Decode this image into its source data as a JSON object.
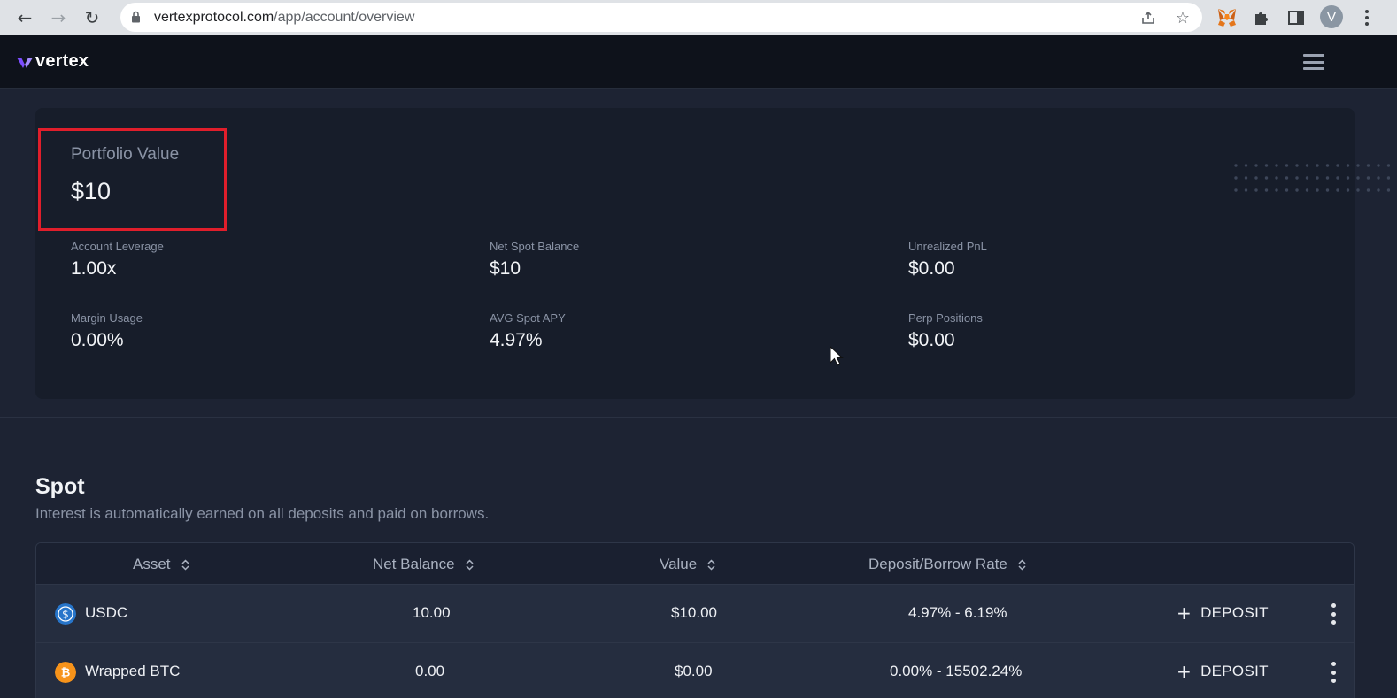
{
  "browser": {
    "url_host": "vertexprotocol.com",
    "url_path": "/app/account/overview",
    "avatar_letter": "V"
  },
  "app": {
    "logo_text": "vertex",
    "accent_color": "#7c4dff"
  },
  "summary": {
    "portfolio_label": "Portfolio Value",
    "portfolio_value": "$10",
    "stats": [
      {
        "label": "Account Leverage",
        "value": "1.00x"
      },
      {
        "label": "Net Spot Balance",
        "value": "$10"
      },
      {
        "label": "Unrealized PnL",
        "value": "$0.00"
      },
      {
        "label": "Margin Usage",
        "value": "0.00%"
      },
      {
        "label": "AVG Spot APY",
        "value": "4.97%"
      },
      {
        "label": "Perp Positions",
        "value": "$0.00"
      }
    ]
  },
  "spot": {
    "title": "Spot",
    "subtitle": "Interest is automatically earned on all deposits and paid on borrows.",
    "columns": [
      "Asset",
      "Net Balance",
      "Value",
      "Deposit/Borrow Rate"
    ],
    "rows": [
      {
        "asset": "USDC",
        "net_balance": "10.00",
        "value": "$10.00",
        "rate": "4.97% - 6.19%",
        "action": "DEPOSIT",
        "icon": "usdc-icon",
        "icon_color": "#2775ca"
      },
      {
        "asset": "Wrapped BTC",
        "net_balance": "0.00",
        "value": "$0.00",
        "rate": "0.00% - 15502.24%",
        "action": "DEPOSIT",
        "icon": "bitcoin-icon",
        "icon_color": "#f7931a"
      }
    ]
  },
  "highlight_color": "#e01e2b"
}
